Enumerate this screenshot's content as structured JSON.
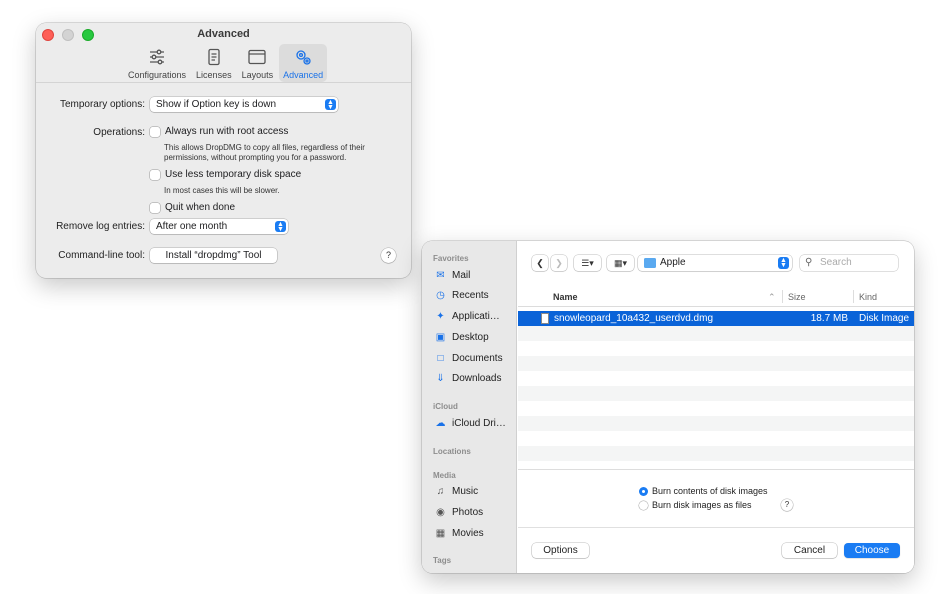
{
  "prefs": {
    "title": "Advanced",
    "tabs": [
      {
        "label": "Configurations",
        "icon": "sliders-icon"
      },
      {
        "label": "Licenses",
        "icon": "scroll-icon"
      },
      {
        "label": "Layouts",
        "icon": "window-icon"
      },
      {
        "label": "Advanced",
        "icon": "gears-icon",
        "active": true
      }
    ],
    "temporary_options_label": "Temporary options:",
    "temporary_options_value": "Show if Option key is down",
    "operations_label": "Operations:",
    "root_access_label": "Always run with root access",
    "root_access_checked": false,
    "root_access_note": "This allows DropDMG to copy all files, regardless of their permissions, without prompting you for a password.",
    "less_disk_label": "Use less temporary disk space",
    "less_disk_checked": false,
    "less_disk_note": "In most cases this will be slower.",
    "quit_label": "Quit when done",
    "quit_checked": false,
    "remove_log_label": "Remove log entries:",
    "remove_log_value": "After one month",
    "cli_label": "Command-line tool:",
    "cli_button": "Install “dropdmg” Tool",
    "help": "?"
  },
  "dialog": {
    "sidebar": {
      "favorites_header": "Favorites",
      "favorites": [
        {
          "label": "Mail",
          "icon": "mail-icon"
        },
        {
          "label": "Recents",
          "icon": "clock-icon"
        },
        {
          "label": "Applicati…",
          "icon": "applications-icon"
        },
        {
          "label": "Desktop",
          "icon": "desktop-icon"
        },
        {
          "label": "Documents",
          "icon": "document-icon"
        },
        {
          "label": "Downloads",
          "icon": "download-icon"
        }
      ],
      "icloud_header": "iCloud",
      "icloud": [
        {
          "label": "iCloud Dri…",
          "icon": "cloud-icon"
        }
      ],
      "locations_header": "Locations",
      "media_header": "Media",
      "media": [
        {
          "label": "Music",
          "icon": "music-icon"
        },
        {
          "label": "Photos",
          "icon": "camera-icon"
        },
        {
          "label": "Movies",
          "icon": "film-icon"
        }
      ],
      "tags_header": "Tags"
    },
    "location": "Apple",
    "search_placeholder": "Search",
    "columns": {
      "name": "Name",
      "size": "Size",
      "kind": "Kind"
    },
    "files": [
      {
        "name": "snowleopard_10a432_userdvd.dmg",
        "size": "18.7 MB",
        "kind": "Disk Image",
        "selected": true
      }
    ],
    "radio_burn_contents": "Burn contents of disk images",
    "radio_burn_files": "Burn disk images as files",
    "burn_contents_selected": true,
    "help": "?",
    "options_button": "Options",
    "cancel_button": "Cancel",
    "choose_button": "Choose"
  },
  "colors": {
    "accent": "#1a7cf3",
    "selection": "#0a63d8"
  }
}
